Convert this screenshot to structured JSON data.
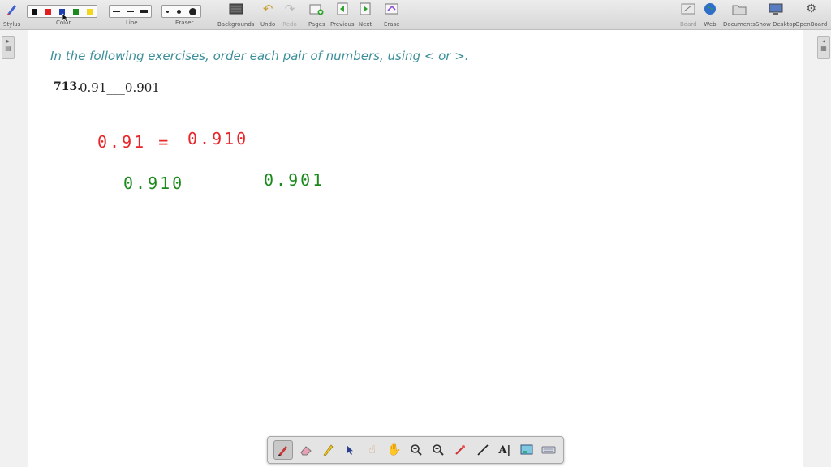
{
  "toolbar": {
    "stylus": "Stylus",
    "color": "Color",
    "line": "Line",
    "eraser": "Eraser",
    "backgrounds": "Backgrounds",
    "undo": "Undo",
    "redo": "Redo",
    "pages": "Pages",
    "previous": "Previous",
    "next": "Next",
    "erase": "Erase",
    "board": "Board",
    "web": "Web",
    "documents": "Documents",
    "show_desktop": "Show Desktop",
    "openboard": "OpenBoard",
    "swatch_colors": [
      "#111111",
      "#e02020",
      "#1f3fb0",
      "#1d8a1d",
      "#f2d81c"
    ]
  },
  "page": {
    "instruction": "In the following exercises, order each pair of numbers, using < or >.",
    "exercise_number": "713.",
    "exercise_text": "0.91___0.901"
  },
  "handwriting": {
    "line1_left": "0.91 =",
    "line1_right": "0.910",
    "line2_left": "0.910",
    "line2_right": "0.901",
    "color_red": "#e8262a",
    "color_green": "#1b8a1b"
  },
  "dock": {
    "icons": [
      "pen-icon",
      "eraser-icon",
      "highlighter-icon",
      "pointer-icon",
      "laser-icon",
      "hand-icon",
      "zoom-in-icon",
      "zoom-out-icon",
      "capture-icon",
      "line-icon",
      "text-icon",
      "screen-icon",
      "keyboard-icon"
    ]
  }
}
